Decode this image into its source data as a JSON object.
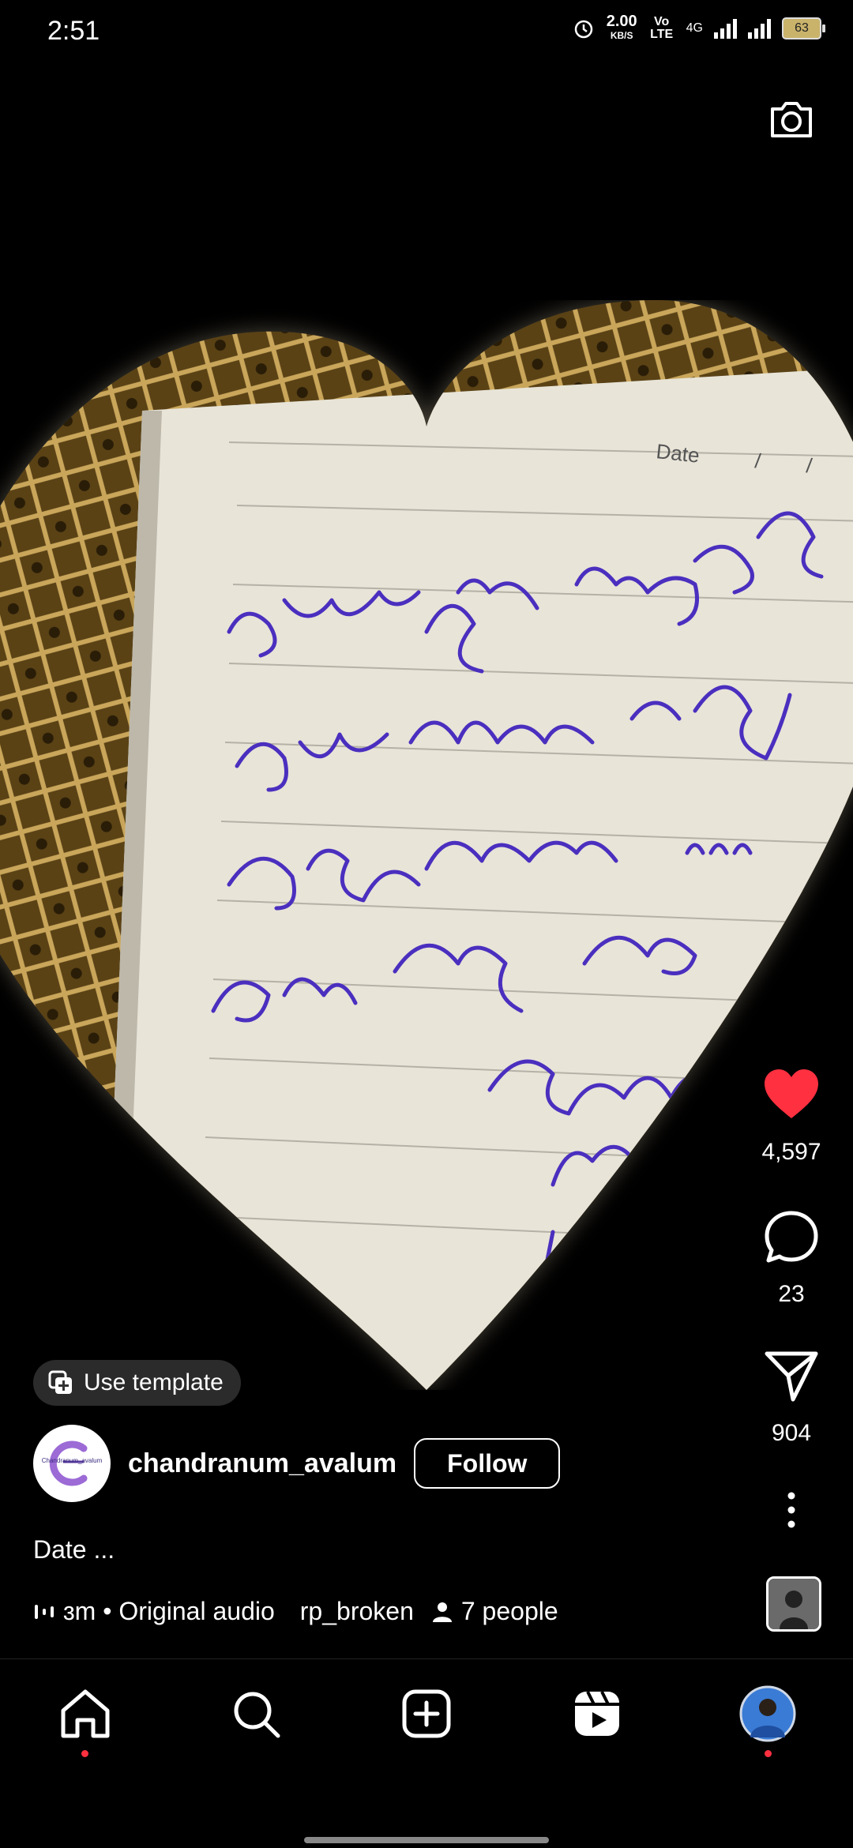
{
  "status_bar": {
    "time": "2:51",
    "speed": "2.00",
    "speed_unit": "KB/S",
    "network": "Vo LTE",
    "network_gen": "4G",
    "battery": "63"
  },
  "post": {
    "use_template_label": "Use template",
    "username": "chandranum_avalum",
    "avatar_text": "Chandranum_avalum",
    "follow_label": "Follow",
    "caption": "Date ...",
    "audio_text": "ɜm • Original audio",
    "tagged_user": "rp_broken",
    "people_label": "7 people"
  },
  "actions": {
    "likes": "4,597",
    "comments": "23",
    "shares": "904"
  },
  "colors": {
    "like_red": "#ff3040",
    "paper": "#e6e2d6",
    "ink": "#4a2fbf"
  },
  "icons": [
    "camera-icon",
    "heart-icon",
    "comment-icon",
    "share-icon",
    "more-icon",
    "home-icon",
    "search-icon",
    "create-icon",
    "reels-icon",
    "profile-avatar"
  ]
}
